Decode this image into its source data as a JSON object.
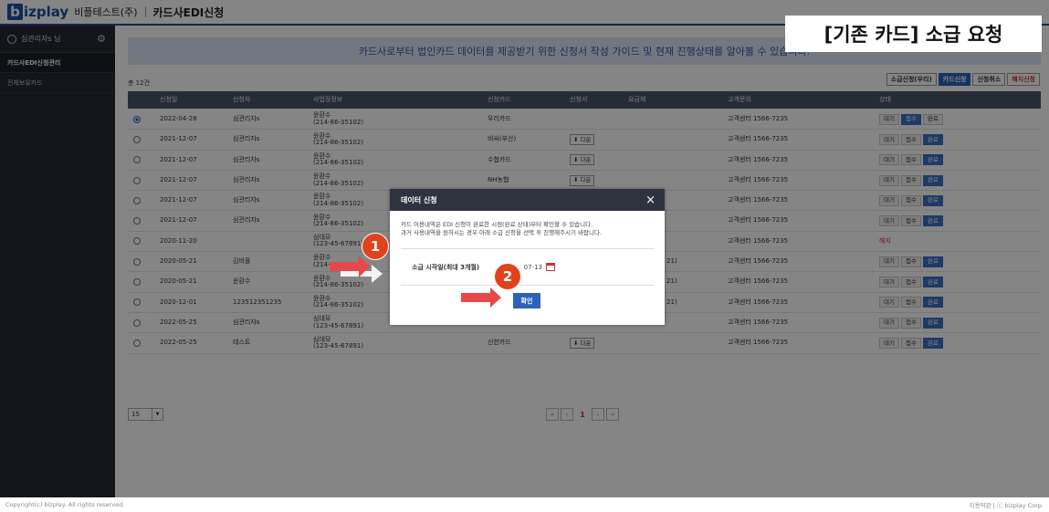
{
  "topbar": {
    "logo_b": "b",
    "logo_text": "izplay",
    "company": "비플테스트(주)",
    "title": "카드사EDI신청"
  },
  "sidebar": {
    "user": "심관리자s 님",
    "items": [
      {
        "label": "카드사EDI신청관리"
      },
      {
        "label": "전체보유카드"
      }
    ]
  },
  "overlay_label": "[기존 카드] 소급 요청",
  "banner": "카드사로부터 법인카드 데이터를 제공받기 위한 신청서 작성 가이드 및 현재 진행상태를 알아볼 수 있습니다.",
  "count": "총 12건",
  "toolbar": {
    "retro": "소급신청(우리)",
    "card_apply": "카드신청",
    "cancel": "신청취소",
    "terminate": "해지신청"
  },
  "columns": [
    "신청일",
    "신청자",
    "사업장정보",
    "신청카드",
    "신청서",
    "요금제",
    "고객문의",
    "상태"
  ],
  "rows": [
    {
      "date": "2022-04-28",
      "user": "심관리자s",
      "biz1": "윤환수",
      "biz2": "(214-86-35102)",
      "card": "우리카드",
      "doc": "",
      "plan": "",
      "contact": "고객센터 1566-7235",
      "s1": "대기",
      "s2": "접수",
      "s3": "완료",
      "on": "접수"
    },
    {
      "date": "2021-12-07",
      "user": "심관리자s",
      "biz1": "윤환수",
      "biz2": "(214-86-35102)",
      "card": "비씨(부산)",
      "doc": "⬇ 다운",
      "plan": "",
      "contact": "고객센터 1566-7235",
      "s1": "대기",
      "s2": "접수",
      "s3": "완료",
      "on": "완료"
    },
    {
      "date": "2021-12-07",
      "user": "심관리자s",
      "biz1": "윤환수",
      "biz2": "(214-86-35102)",
      "card": "수협카드",
      "doc": "⬇ 다운",
      "plan": "",
      "contact": "고객센터 1566-7235",
      "s1": "대기",
      "s2": "접수",
      "s3": "완료",
      "on": "완료"
    },
    {
      "date": "2021-12-07",
      "user": "심관리자s",
      "biz1": "윤환수",
      "biz2": "(214-86-35102)",
      "card": "NH농협",
      "doc": "⬇ 다운",
      "plan": "",
      "contact": "고객센터 1566-7235",
      "s1": "대기",
      "s2": "접수",
      "s3": "완료",
      "on": "완료"
    },
    {
      "date": "2021-12-07",
      "user": "심관리자s",
      "biz1": "윤환수",
      "biz2": "(214-86-35102)",
      "card": "",
      "doc": "",
      "plan": "",
      "contact": "고객센터 1566-7235",
      "s1": "대기",
      "s2": "접수",
      "s3": "완료",
      "on": "완료"
    },
    {
      "date": "2021-12-07",
      "user": "심관리자s",
      "biz1": "윤환수",
      "biz2": "(214-86-35102)",
      "card": "",
      "doc": "",
      "plan": "",
      "contact": "고객센터 1566-7235",
      "s1": "대기",
      "s2": "접수",
      "s3": "완료",
      "on": "완료"
    },
    {
      "date": "2020-11-20",
      "user": "",
      "biz1": "심대모",
      "biz2": "(123-45-67891)",
      "card": "",
      "doc": "",
      "plan": "",
      "contact": "고객센터 1566-7235",
      "s1": "해지",
      "s2": "",
      "s3": "",
      "on": ""
    },
    {
      "date": "2020-05-21",
      "user": "김비플",
      "biz1": "윤환수",
      "biz2": "(214-86-35102)",
      "card": "",
      "doc": "",
      "plan": "21)",
      "contact": "고객센터 1566-7235",
      "s1": "대기",
      "s2": "접수",
      "s3": "완료",
      "on": "완료"
    },
    {
      "date": "2020-05-21",
      "user": "윤환수",
      "biz1": "윤환수",
      "biz2": "(214-86-35102)",
      "card": "",
      "doc": "",
      "plan": "21)",
      "contact": "고객센터 1566-7235",
      "s1": "대기",
      "s2": "접수",
      "s3": "완료",
      "on": "완료"
    },
    {
      "date": "2020-12-01",
      "user": "123512351235",
      "biz1": "윤환수",
      "biz2": "(214-86-35102)",
      "card": "",
      "doc": "",
      "plan": "21)",
      "contact": "고객센터 1566-7235",
      "s1": "대기",
      "s2": "접수",
      "s3": "완료",
      "on": "완료"
    },
    {
      "date": "2022-05-25",
      "user": "심관리자s",
      "biz1": "심대모",
      "biz2": "(123-45-67891)",
      "card": "",
      "doc": "",
      "plan": "",
      "contact": "고객센터 1566-7235",
      "s1": "대기",
      "s2": "접수",
      "s3": "완료",
      "on": "완료"
    },
    {
      "date": "2022-05-25",
      "user": "테스트",
      "biz1": "심대모",
      "biz2": "(123-45-67891)",
      "card": "신한카드",
      "doc": "⬇ 다운",
      "plan": "",
      "contact": "고객센터 1566-7235",
      "s1": "대기",
      "s2": "접수",
      "s3": "완료",
      "on": "완료"
    }
  ],
  "pager": {
    "size": "15",
    "current": "1",
    "first": "«",
    "prev": "‹",
    "next": "›",
    "last": "»"
  },
  "footer": {
    "left": "Copyright(c) bizplay. All rights reserved.",
    "right": "이용약관 | ⓒ bizplay Corp."
  },
  "modal": {
    "title": "데이터 신청",
    "close": "×",
    "desc1": "카드 이용내역은 EDI 신청이 완료한 시점(완료 상태)부터 확인할 수 있습니다.",
    "desc2": "과거 사용내역을 원하시는 경우 아래 소급 신청을 선택 후 진행해주시기 바랍니다.",
    "field_label": "소급 시작일(최대 3개월)",
    "date_value": "07-13",
    "confirm": "확인"
  },
  "badges": [
    "1",
    "2"
  ],
  "colors": {
    "accent": "#2d63b7",
    "badge": "#e2421b",
    "arrow": "#e8484a"
  }
}
